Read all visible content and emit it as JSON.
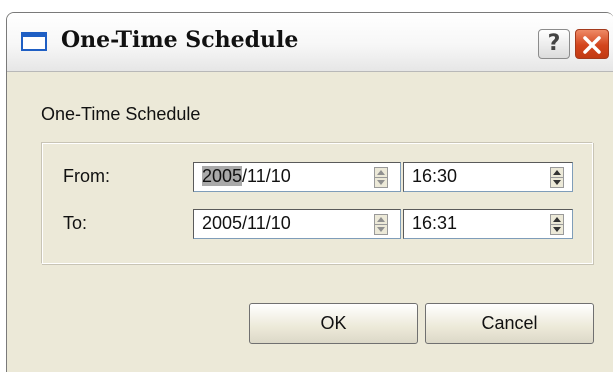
{
  "window": {
    "title": "One-Time Schedule",
    "help_glyph": "?"
  },
  "dialog": {
    "section_title": "One-Time Schedule",
    "from": {
      "label": "From:",
      "date_selected": "2005",
      "date_rest": "/11/10",
      "time": "16:30"
    },
    "to": {
      "label": "To:",
      "date": "2005/11/10",
      "time": "16:31"
    },
    "buttons": {
      "ok": "OK",
      "cancel": "Cancel"
    }
  },
  "icons": {
    "app": "window-icon",
    "help": "help-icon",
    "close": "close-icon",
    "spin": "spin-updown-icon"
  },
  "colors": {
    "close_button": "#d3451d",
    "selection": "#a9a9a9",
    "dialog_background": "#ece9d8",
    "title_icon": "#1f5fc4"
  }
}
